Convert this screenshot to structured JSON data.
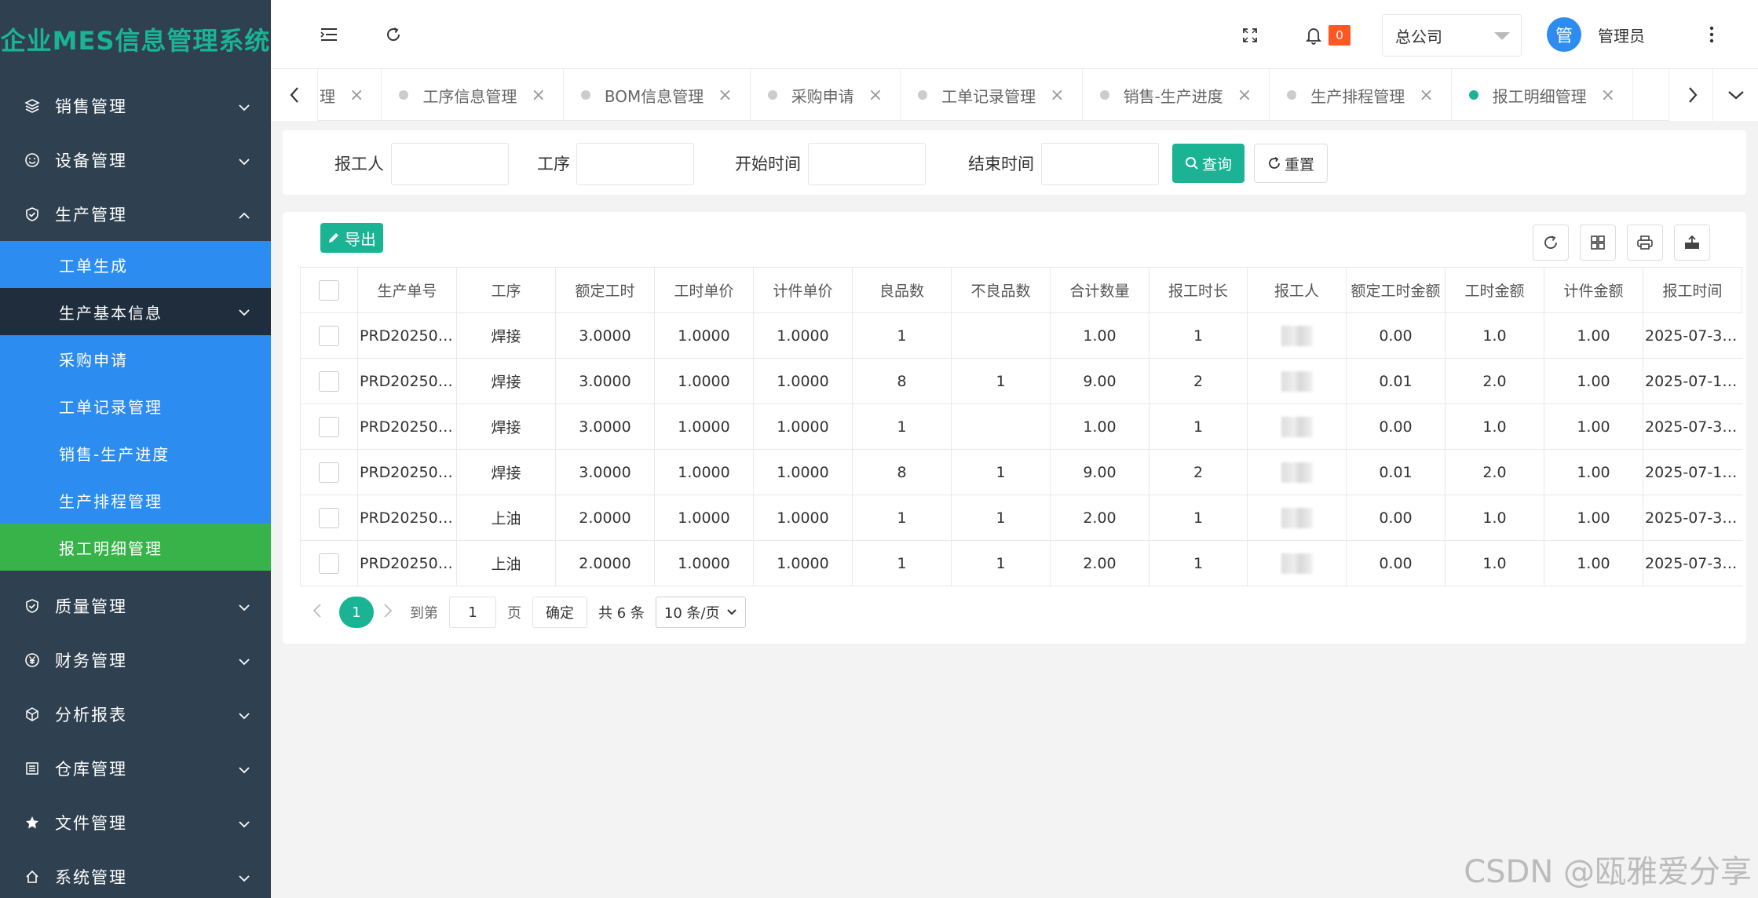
{
  "app": {
    "title": "企业MES信息管理系统"
  },
  "sidebar": {
    "items": [
      {
        "label": "销售管理",
        "icon": "layers-icon"
      },
      {
        "label": "设备管理",
        "icon": "smile-icon"
      },
      {
        "label": "生产管理",
        "icon": "shield-check-icon",
        "expanded": true
      }
    ],
    "production_sub": [
      {
        "label": "工单生成"
      },
      {
        "label": "生产基本信息"
      },
      {
        "label": "采购申请"
      },
      {
        "label": "工单记录管理"
      },
      {
        "label": "销售-生产进度"
      },
      {
        "label": "生产排程管理"
      },
      {
        "label": "报工明细管理",
        "active": true
      }
    ],
    "items_after": [
      {
        "label": "质量管理",
        "icon": "shield-check-icon"
      },
      {
        "label": "财务管理",
        "icon": "yen-icon"
      },
      {
        "label": "分析报表",
        "icon": "cube-icon"
      },
      {
        "label": "仓库管理",
        "icon": "warehouse-icon"
      },
      {
        "label": "文件管理",
        "icon": "star-icon"
      },
      {
        "label": "系统管理",
        "icon": "home-icon"
      }
    ]
  },
  "header": {
    "notification_count": "0",
    "company": "总公司",
    "avatar_text": "管",
    "username": "管理员"
  },
  "tabs": [
    {
      "label": "理"
    },
    {
      "label": "工序信息管理"
    },
    {
      "label": "BOM信息管理"
    },
    {
      "label": "采购申请"
    },
    {
      "label": "工单记录管理"
    },
    {
      "label": "销售-生产进度"
    },
    {
      "label": "生产排程管理"
    },
    {
      "label": "报工明细管理",
      "active": true
    }
  ],
  "search": {
    "reporter_label": "报工人",
    "process_label": "工序",
    "start_label": "开始时间",
    "end_label": "结束时间",
    "query_label": "查询",
    "reset_label": "重置"
  },
  "toolbar": {
    "export_label": "导出"
  },
  "table": {
    "columns": [
      "生产单号",
      "工序",
      "额定工时",
      "工时单价",
      "计件单价",
      "良品数",
      "不良品数",
      "合计数量",
      "报工时长",
      "报工人",
      "额定工时金额",
      "工时金额",
      "计件金额",
      "报工时间"
    ],
    "rows": [
      [
        "PRD20250…",
        "焊接",
        "3.0000",
        "1.0000",
        "1.0000",
        "1",
        "",
        "1.00",
        "1",
        "",
        "0.00",
        "1.0",
        "1.00",
        "2025-07-3…"
      ],
      [
        "PRD20250…",
        "焊接",
        "3.0000",
        "1.0000",
        "1.0000",
        "8",
        "1",
        "9.00",
        "2",
        "",
        "0.01",
        "2.0",
        "1.00",
        "2025-07-1…"
      ],
      [
        "PRD20250…",
        "焊接",
        "3.0000",
        "1.0000",
        "1.0000",
        "1",
        "",
        "1.00",
        "1",
        "",
        "0.00",
        "1.0",
        "1.00",
        "2025-07-3…"
      ],
      [
        "PRD20250…",
        "焊接",
        "3.0000",
        "1.0000",
        "1.0000",
        "8",
        "1",
        "9.00",
        "2",
        "",
        "0.01",
        "2.0",
        "1.00",
        "2025-07-1…"
      ],
      [
        "PRD20250…",
        "上油",
        "2.0000",
        "1.0000",
        "1.0000",
        "1",
        "1",
        "2.00",
        "1",
        "",
        "0.00",
        "1.0",
        "1.00",
        "2025-07-3…"
      ],
      [
        "PRD20250…",
        "上油",
        "2.0000",
        "1.0000",
        "1.0000",
        "1",
        "1",
        "2.00",
        "1",
        "",
        "0.00",
        "1.0",
        "1.00",
        "2025-07-3…"
      ]
    ]
  },
  "pager": {
    "current": "1",
    "goto_label": "到第",
    "goto_value": "1",
    "page_unit": "页",
    "confirm": "确定",
    "total": "共 6 条",
    "page_size": "10 条/页"
  },
  "watermark": "CSDN @瓯雅爱分享",
  "colors": {
    "sidebar_bg": "#2f4050",
    "accent_green": "#1ab394",
    "submenu_blue": "#2d8cf0",
    "active_green": "#37b34a",
    "badge_orange": "#ff5722"
  }
}
